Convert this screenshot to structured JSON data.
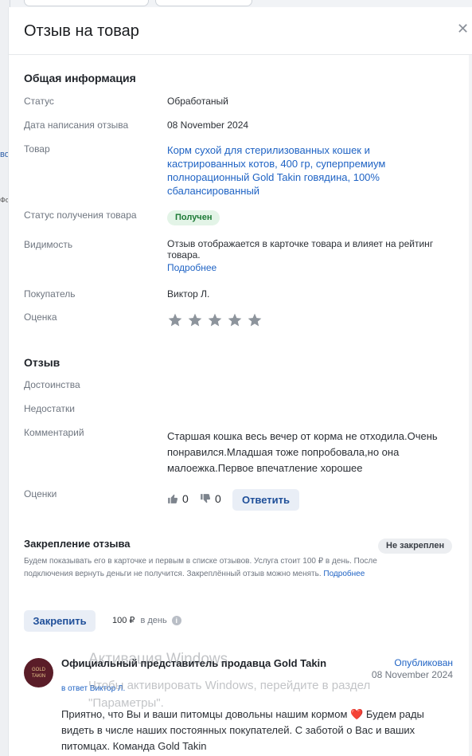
{
  "background": {
    "fragments": [
      "во",
      "Фо"
    ]
  },
  "header": {
    "title": "Отзыв на товар"
  },
  "general": {
    "heading": "Общая информация",
    "status_label": "Статус",
    "status_value": "Обработаный",
    "date_label": "Дата написания отзыва",
    "date_value": "08 November 2024",
    "product_label": "Товар",
    "product_value": "Корм сухой для стерилизованных кошек и кастрированных котов, 400 гр, суперпремиум полнорационный Gold Takin говядина, 100% сбалансированный",
    "receipt_label": "Статус получения товара",
    "receipt_value": "Получен",
    "visibility_label": "Видимость",
    "visibility_value": "Отзыв отображается в карточке товара и влияет на рейтинг товара.",
    "visibility_link": "Подробнее",
    "buyer_label": "Покупатель",
    "buyer_value": "Виктор Л.",
    "rating_label": "Оценка",
    "rating_value": 0,
    "rating_max": 5
  },
  "review": {
    "heading": "Отзыв",
    "pros_label": "Достоинства",
    "cons_label": "Недостатки",
    "comment_label": "Комментарий",
    "comment_value": "Старшая кошка весь вечер от корма не отходила.Очень понравился.Младшая тоже попробовала,но она малоежка.Первое впечатление хорошее",
    "votes_label": "Оценки",
    "likes": "0",
    "dislikes": "0",
    "reply_button": "Ответить"
  },
  "pin": {
    "heading": "Закрепление отзыва",
    "badge": "Не закреплен",
    "description": "Будем показывать его в карточке и первым в списке отзывов. Услуга стоит 100 ₽ в день. После подключения вернуть деньги не получится. Закреплённый отзыв можно менять.",
    "description_link": "Подробнее",
    "button": "Закрепить",
    "price": "100 ₽",
    "price_unit": "в день"
  },
  "reply": {
    "avatar_line1": "GOLD",
    "avatar_line2": "TAKIN",
    "author": "Официальный представитель продавца Gold Takin",
    "status": "Опубликован",
    "date": "08 November 2024",
    "in_reply_to": "в ответ Виктор Л.",
    "text": "Приятно, что Вы и ваши питомцы довольны нашим кормом ❤️ Будем рады видеть в числе наших постоянных покупателей. С заботой о Вас и ваших питомцах. Команда Gold Takin"
  },
  "watermark": {
    "line1": "Активация Windows",
    "line2": "Чтобы активировать Windows, перейдите в раздел",
    "line3": "\"Параметры\"."
  },
  "colors": {
    "accent": "#1f63c4",
    "success_bg": "#e3f4e7",
    "star": "#8d949c"
  }
}
